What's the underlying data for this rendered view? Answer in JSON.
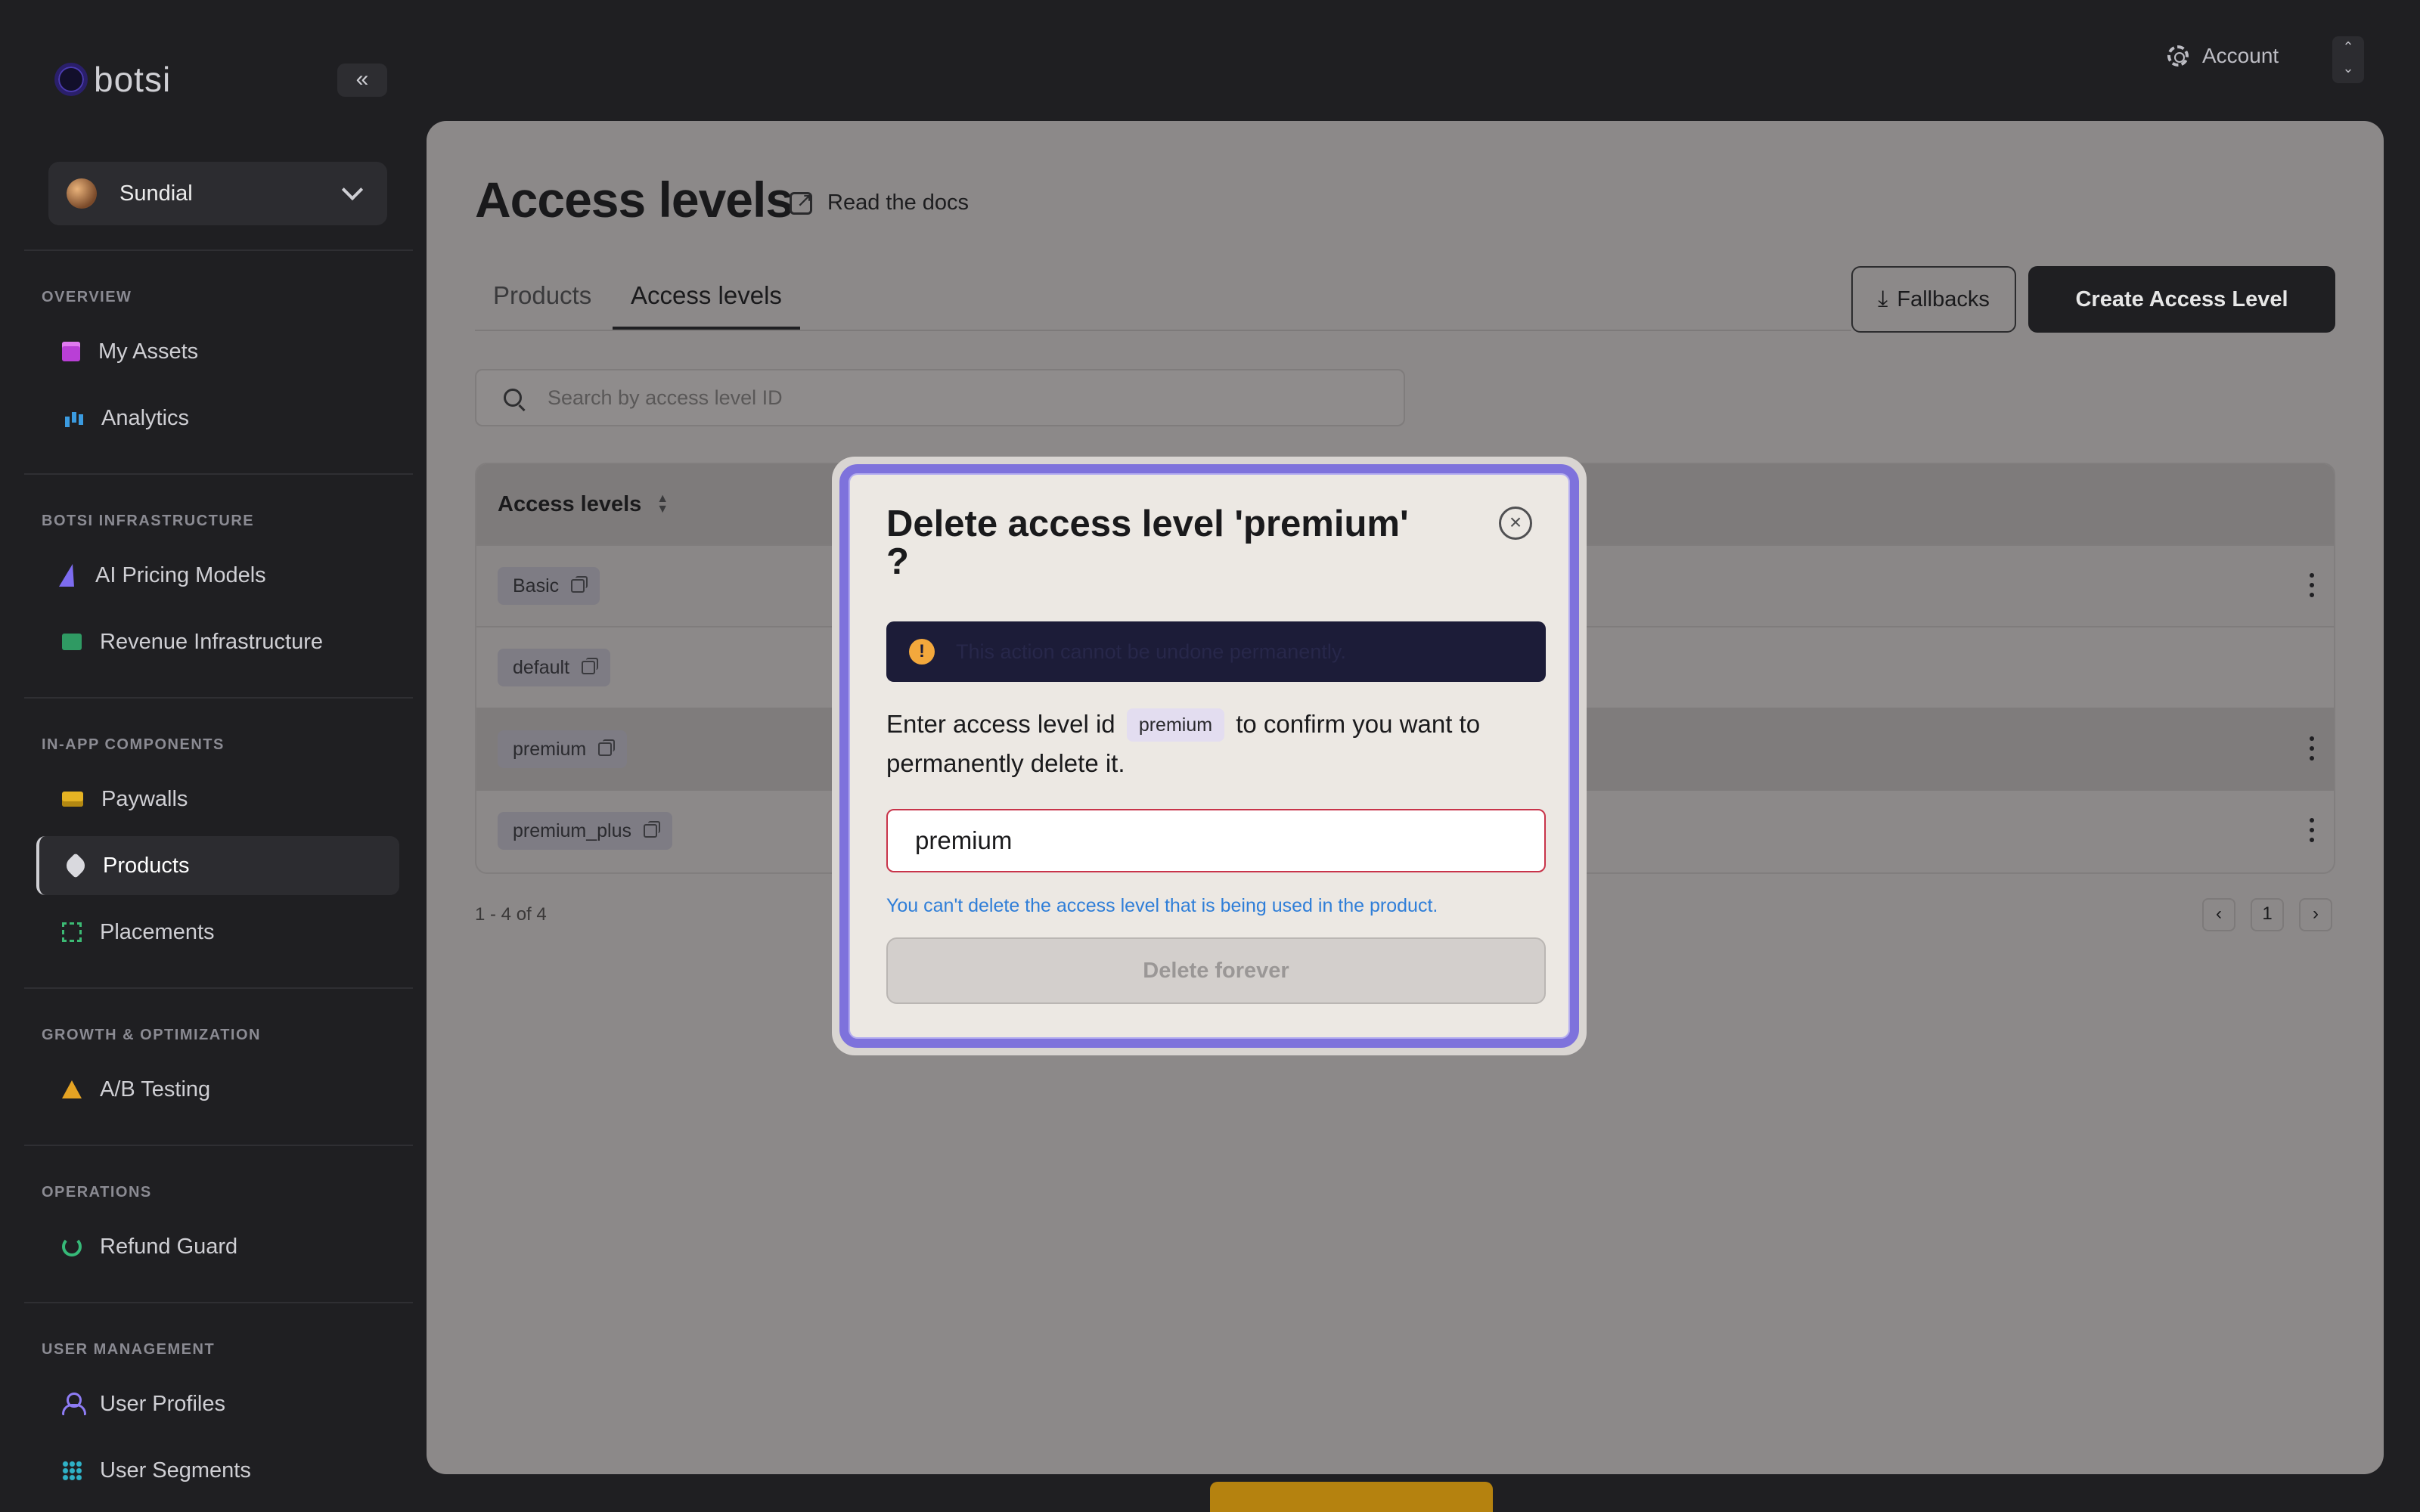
{
  "brand": {
    "name": "botsi"
  },
  "workspace": {
    "name": "Sundial"
  },
  "sidebar": {
    "sections": [
      {
        "label": "OVERVIEW",
        "items": [
          {
            "label": "My Assets",
            "icon": "assets-icon"
          },
          {
            "label": "Analytics",
            "icon": "analytics-icon"
          }
        ]
      },
      {
        "label": "BOTSI INFRASTRUCTURE",
        "items": [
          {
            "label": "AI Pricing Models",
            "icon": "bolt-icon"
          },
          {
            "label": "Revenue Infrastructure",
            "icon": "revenue-icon"
          }
        ]
      },
      {
        "label": "IN-APP COMPONENTS",
        "items": [
          {
            "label": "Paywalls",
            "icon": "paywall-icon"
          },
          {
            "label": "Products",
            "icon": "tag-icon",
            "active": true
          },
          {
            "label": "Placements",
            "icon": "placement-icon"
          }
        ]
      },
      {
        "label": "GROWTH & OPTIMIZATION",
        "items": [
          {
            "label": "A/B Testing",
            "icon": "flask-icon"
          }
        ]
      },
      {
        "label": "OPERATIONS",
        "items": [
          {
            "label": "Refund Guard",
            "icon": "refund-icon"
          }
        ]
      },
      {
        "label": "USER MANAGEMENT",
        "items": [
          {
            "label": "User Profiles",
            "icon": "user-icon"
          },
          {
            "label": "User Segments",
            "icon": "segments-icon"
          }
        ]
      }
    ]
  },
  "topbar": {
    "account_label": "Account"
  },
  "page": {
    "title": "Access levels",
    "docs_link": "Read the docs",
    "tabs": [
      {
        "label": "Products"
      },
      {
        "label": "Access levels",
        "active": true
      }
    ],
    "fallbacks_label": "Fallbacks",
    "create_label": "Create Access Level",
    "search_placeholder": "Search by access level ID"
  },
  "table": {
    "header": "Access levels",
    "rows": [
      {
        "id": "Basic"
      },
      {
        "id": "default"
      },
      {
        "id": "premium"
      },
      {
        "id": "premium_plus"
      }
    ],
    "count_text": "1 - 4 of 4",
    "current_page": "1"
  },
  "modal": {
    "title": "Delete access level 'premium' ?",
    "warning": "This action cannot be undone permanently.",
    "desc_before": "Enter access level id",
    "desc_chip": "premium",
    "desc_after": "to confirm you want to permanently delete it.",
    "input_value": "premium",
    "error": "You can't delete the access level that is being used in the product.",
    "delete_label": "Delete forever"
  },
  "colors": {
    "accent": "#7e72dc",
    "error": "#c8344a",
    "info": "#2f7ed8",
    "warning": "#f3a83c"
  }
}
